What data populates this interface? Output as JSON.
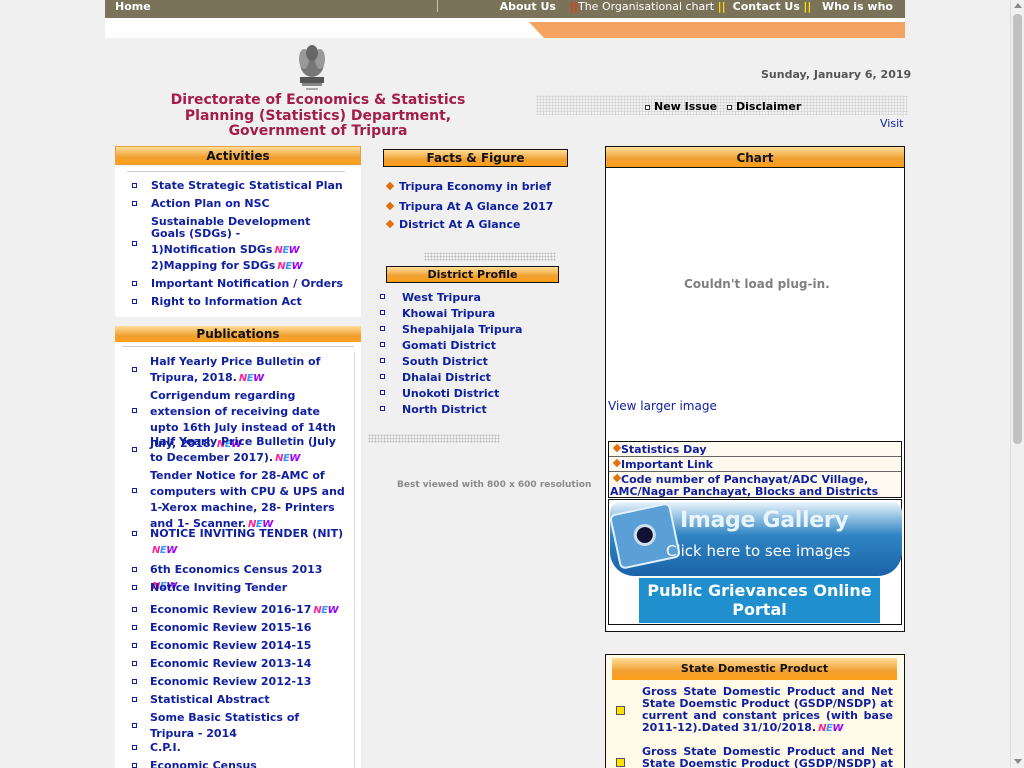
{
  "topnav": {
    "home": "Home",
    "about": "About Us",
    "org_chart": "The Organisational chart",
    "separator": "||",
    "contact": "Contact Us",
    "whoiswho": "Who is who"
  },
  "header": {
    "title_line1": "Directorate of Economics & Statistics",
    "title_line2": "Planning (Statistics) Department,",
    "title_line3": "Government of Tripura",
    "date": "Sunday, January 6, 2019",
    "new_issue": "New Issue",
    "disclaimer": "Disclaimer",
    "visit": "Visit"
  },
  "new_badge": [
    "N",
    "E",
    "W"
  ],
  "activities": {
    "title": "Activities",
    "items": [
      "State Strategic Statistical Plan",
      "Action Plan on NSC",
      "Sustainable Development Goals (SDGs) -",
      "1)Notification SDGs",
      "2)Mapping for SDGs",
      "Important Notification / Orders",
      "Right to Information Act"
    ]
  },
  "publications": {
    "title": "Publications",
    "items": [
      "Half Yearly Price Bulletin of Tripura, 2018.",
      "Corrigendum regarding extension of receiving date upto 16th July instead of 14th July, 2018.",
      "Half Yearly Price Bulletin (July to December 2017).",
      "Tender Notice for 28-AMC of computers with CPU & UPS and 1-Xerox machine, 28- Printers and 1- Scanner.",
      "NOTICE INVITING TENDER (NIT)",
      "6th Economics Census 2013",
      "Notice Inviting Tender",
      "Economic Review 2016-17",
      "Economic Review 2015-16",
      "Economic Review 2014-15",
      "Economic Review 2013-14",
      "Economic Review 2012-13",
      "Statistical Abstract",
      "Some Basic Statistics of Tripura - 2014",
      "C.P.I.",
      "Economic Census"
    ]
  },
  "facts": {
    "title": "Facts & Figure",
    "items": [
      "Tripura Economy in brief",
      "Tripura At A Glance 2017",
      "District At A Glance"
    ]
  },
  "district_profile": {
    "title": "District  Profile",
    "items": [
      "West Tripura",
      "Khowai Tripura",
      "Shepahijala Tripura",
      "Gomati District",
      "South District",
      "Dhalai District",
      "Unokoti District",
      "North District"
    ],
    "best_viewed": "Best viewed with 800 x 600 resolution"
  },
  "chart": {
    "title": "Chart",
    "plugin_msg": "Couldn't load plug-in.",
    "view_larger": "View larger image",
    "links": [
      "Statistics Day",
      "Important Link",
      "Code number of Panchayat/ADC Village, AMC/Nagar Panchayat, Blocks and Districts"
    ],
    "gallery_title": "Image Gallery",
    "gallery_sub": "Click here to see images",
    "pgo_line1": "Public Grievances Online",
    "pgo_line2": "Portal"
  },
  "sdp": {
    "title": "State Domestic Product",
    "items": [
      "Gross State Domestic Product and Net State Doemstic Product (GSDP/NSDP) at current and constant prices (with base 2011-12).Dated 31/10/2018.",
      "Gross State Domestic Product and Net State Doemstic Product (GSDP/NSDP) at current"
    ]
  }
}
